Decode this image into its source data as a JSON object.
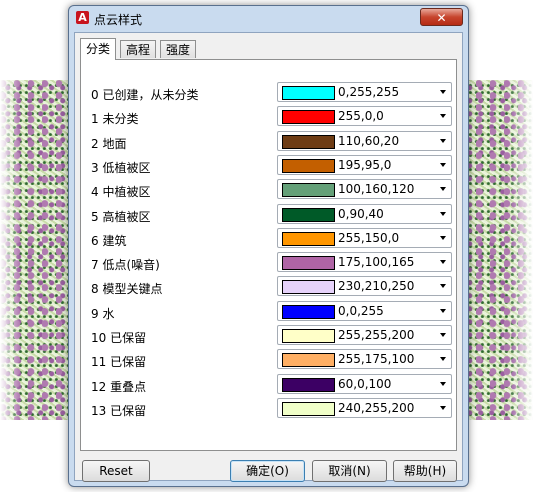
{
  "dialog": {
    "title": "点云样式",
    "close_label": "✕"
  },
  "tabs": [
    {
      "label": "分类",
      "active": true
    },
    {
      "label": "高程",
      "active": false
    },
    {
      "label": "强度",
      "active": false
    }
  ],
  "classes": [
    {
      "label": "0 已创建，从未分类",
      "value": "0,255,255",
      "color": "#00ffff"
    },
    {
      "label": "1 未分类",
      "value": "255,0,0",
      "color": "#ff0000"
    },
    {
      "label": "2 地面",
      "value": "110,60,20",
      "color": "#6e3c14"
    },
    {
      "label": "3 低植被区",
      "value": "195,95,0",
      "color": "#c35f00"
    },
    {
      "label": "4 中植被区",
      "value": "100,160,120",
      "color": "#64a078"
    },
    {
      "label": "5 高植被区",
      "value": "0,90,40",
      "color": "#005a28"
    },
    {
      "label": "6 建筑",
      "value": "255,150,0",
      "color": "#ff9600"
    },
    {
      "label": "7 低点(噪音)",
      "value": "175,100,165",
      "color": "#af64a5"
    },
    {
      "label": "8 模型关键点",
      "value": "230,210,250",
      "color": "#e6d2fa"
    },
    {
      "label": "9 水",
      "value": "0,0,255",
      "color": "#0000ff"
    },
    {
      "label": "10 已保留",
      "value": "255,255,200",
      "color": "#ffffc8"
    },
    {
      "label": "11 已保留",
      "value": "255,175,100",
      "color": "#ffaf64"
    },
    {
      "label": "12 重叠点",
      "value": "60,0,100",
      "color": "#3c0064"
    },
    {
      "label": "13 已保留",
      "value": "240,255,200",
      "color": "#f0ffc8"
    }
  ],
  "buttons": {
    "reset": "Reset",
    "ok": "确定(O)",
    "cancel": "取消(N)",
    "help": "帮助(H)"
  }
}
